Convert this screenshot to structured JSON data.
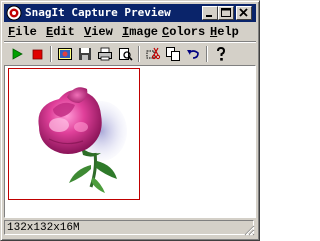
{
  "window": {
    "title": "SnagIt Capture Preview",
    "icon": "snagit-app-icon"
  },
  "title_buttons": {
    "minimize": "minimize-icon",
    "maximize": "maximize-icon",
    "close": "close-icon"
  },
  "menu": {
    "file": {
      "underline": "F",
      "rest": "ile"
    },
    "edit": {
      "underline": "E",
      "rest": "dit"
    },
    "view": {
      "underline": "V",
      "rest": "iew"
    },
    "image": {
      "underline": "I",
      "rest": "mage"
    },
    "colors": {
      "underline": "C",
      "rest": "olors"
    },
    "help": {
      "underline": "H",
      "rest": "elp"
    }
  },
  "toolbar": {
    "icons": [
      "play-icon",
      "stop-icon",
      "capture-icon",
      "save-icon",
      "print-icon",
      "print-preview-icon",
      "cut-icon",
      "copy-icon",
      "undo-icon",
      "help-icon"
    ]
  },
  "preview": {
    "image": "rose-image"
  },
  "status": {
    "text": "132x132x16M"
  },
  "colors": {
    "titlebar": "#0a246a",
    "frame_border": "#c00000",
    "window_face": "#d4d0c8"
  }
}
